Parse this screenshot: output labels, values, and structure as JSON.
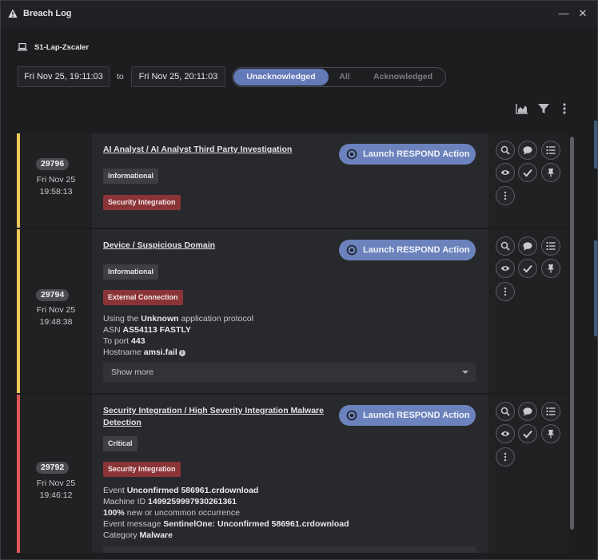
{
  "window": {
    "title": "Breach Log"
  },
  "device": {
    "name": "S1-Lap-Zscaler"
  },
  "filters": {
    "from": "Fri Nov 25, 19:11:03",
    "to_label": "to",
    "to": "Fri Nov 25, 20:11:03",
    "tabs": [
      "Unacknowledged",
      "All",
      "Acknowledged"
    ],
    "selected_tab": "Unacknowledged"
  },
  "colors": {
    "accent": "#6379b8",
    "warning_stripe": "#f0c659",
    "critical_stripe": "#e0575a",
    "tag_red": "#8b3438"
  },
  "launch_label": "Launch RESPOND Action",
  "show_more_label": "Show more",
  "breaches": [
    {
      "id": "29796",
      "date": "Fri Nov 25",
      "time": "19:58:13",
      "title": "AI Analyst / AI Analyst Third Party Investigation",
      "severity": "Informational",
      "category": "Security Integration"
    },
    {
      "id": "29794",
      "date": "Fri Nov 25",
      "time": "19:48:38",
      "title": "Device / Suspicious Domain",
      "severity": "Informational",
      "category": "External Connection",
      "details": {
        "l1_pre": "Using the ",
        "l1_bold": "Unknown",
        "l1_post": " application protocol",
        "l2_pre": "ASN ",
        "l2_bold": "AS54113 FASTLY",
        "l3_pre": "To port ",
        "l3_bold": "443",
        "l4_pre": "Hostname ",
        "l4_bold": "amsi.fail"
      }
    },
    {
      "id": "29792",
      "date": "Fri Nov 25",
      "time": "19:46:12",
      "title_line1": "Security Integration / High Severity Integration Malware",
      "title_line2": "Detection",
      "severity": "Critical",
      "category": "Security Integration",
      "details": {
        "l1_pre": "Event ",
        "l1_bold": "Unconfirmed 586961.crdownload",
        "l2_pre": "Machine ID ",
        "l2_bold": "1499259997930261361",
        "l3_bold": "100%",
        "l3_post": " new or uncommon occurrence",
        "l4_pre": "Event message ",
        "l4_bold": "SentinelOne: Unconfirmed 586961.crdownload",
        "l5_pre": "Category ",
        "l5_bold": "Malware"
      }
    }
  ]
}
